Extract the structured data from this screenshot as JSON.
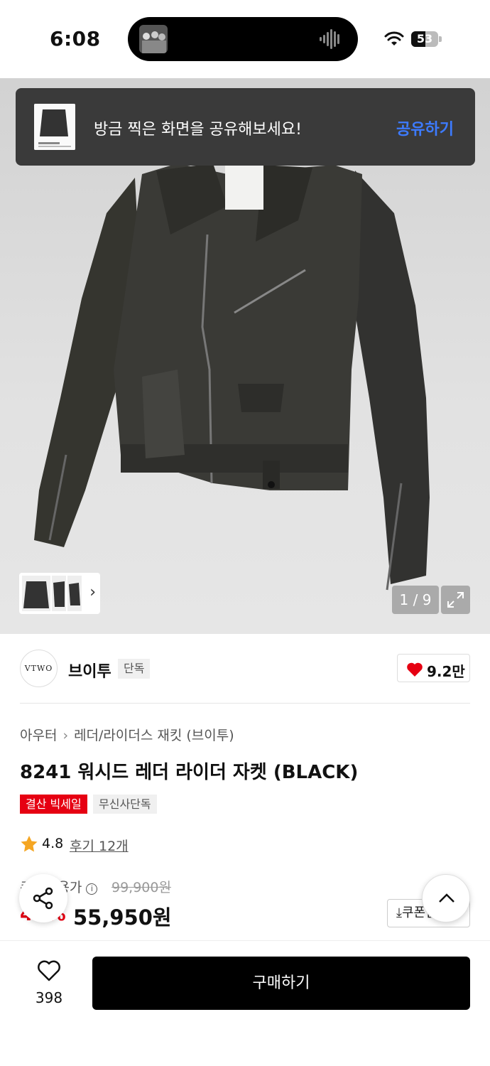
{
  "status_bar": {
    "time": "6:08",
    "battery": "53",
    "battery_level": 0.53
  },
  "share_banner": {
    "message": "방금 찍은 화면을 공유해보세요!",
    "action": "공유하기"
  },
  "gallery": {
    "counter": "1 / 9",
    "image_label": "VTWO"
  },
  "brand": {
    "logo_text": "VTWO",
    "name": "브이투",
    "badge": "단독",
    "likes": "9.2만"
  },
  "breadcrumb": [
    "아우터",
    "레더/라이더스 재킷 (브이투)"
  ],
  "product": {
    "title": "8241 워시드 레더 라이더 자켓 (BLACK)",
    "tags": [
      "결산 빅세일",
      "무신사단독"
    ],
    "rating": "4.8",
    "reviews": "후기 12개",
    "price_label": "쿠폰적용가",
    "original_price": "99,900원",
    "discount": "44%",
    "price": "55,950원",
    "coupon_button": "쿠폰받기"
  },
  "bottom_bar": {
    "wish_count": "398",
    "buy_label": "구매하기"
  },
  "colors": {
    "accent_blue": "#3d7bff",
    "sale_red": "#e60012",
    "heart_red": "#e60012",
    "star": "#f5a623"
  }
}
